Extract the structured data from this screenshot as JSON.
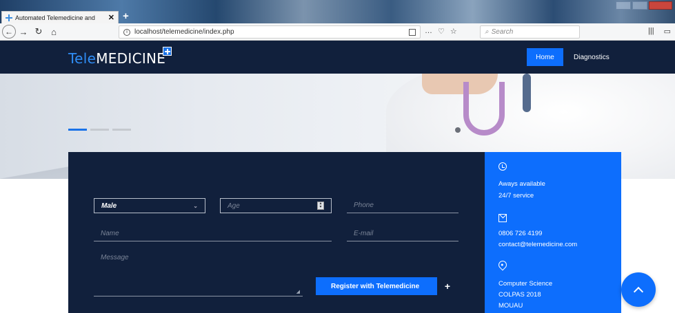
{
  "browser": {
    "tab_title": "Automated Telemedicine and",
    "tab_close": "✕",
    "new_tab": "+",
    "url": "localhost/telemedicine/index.php",
    "url_tail_icons": [
      "…",
      "♡",
      "☆"
    ],
    "search_placeholder": "Search",
    "nav_icons": [
      "back-icon",
      "forward-icon",
      "reload-icon",
      "home-icon"
    ]
  },
  "site": {
    "logo_tele": "Tele",
    "logo_medicine": "MEDICINE",
    "menu": [
      {
        "label": "Home",
        "active": true
      },
      {
        "label": "Diagnostics",
        "active": false
      }
    ]
  },
  "form": {
    "gender_value": "Male",
    "age_placeholder": "Age",
    "phone_placeholder": "Phone",
    "name_placeholder": "Name",
    "email_placeholder": "E-mail",
    "message_placeholder": "Message",
    "submit_label": "Register with Telemedicine",
    "submit_plus": "+"
  },
  "contact": {
    "availability": "Aways available",
    "service": "24/7 service",
    "phone": "0806 726 4199",
    "email": "contact@telemedicine.com",
    "address_line1": "Computer Science",
    "address_line2": "COLPAS 2018",
    "address_line3": "MOUAU"
  },
  "colors": {
    "navy": "#11203c",
    "accent_blue": "#0d6efd",
    "logo_blue": "#2f8df5"
  },
  "slider": {
    "slides": 3,
    "active_index": 0
  }
}
